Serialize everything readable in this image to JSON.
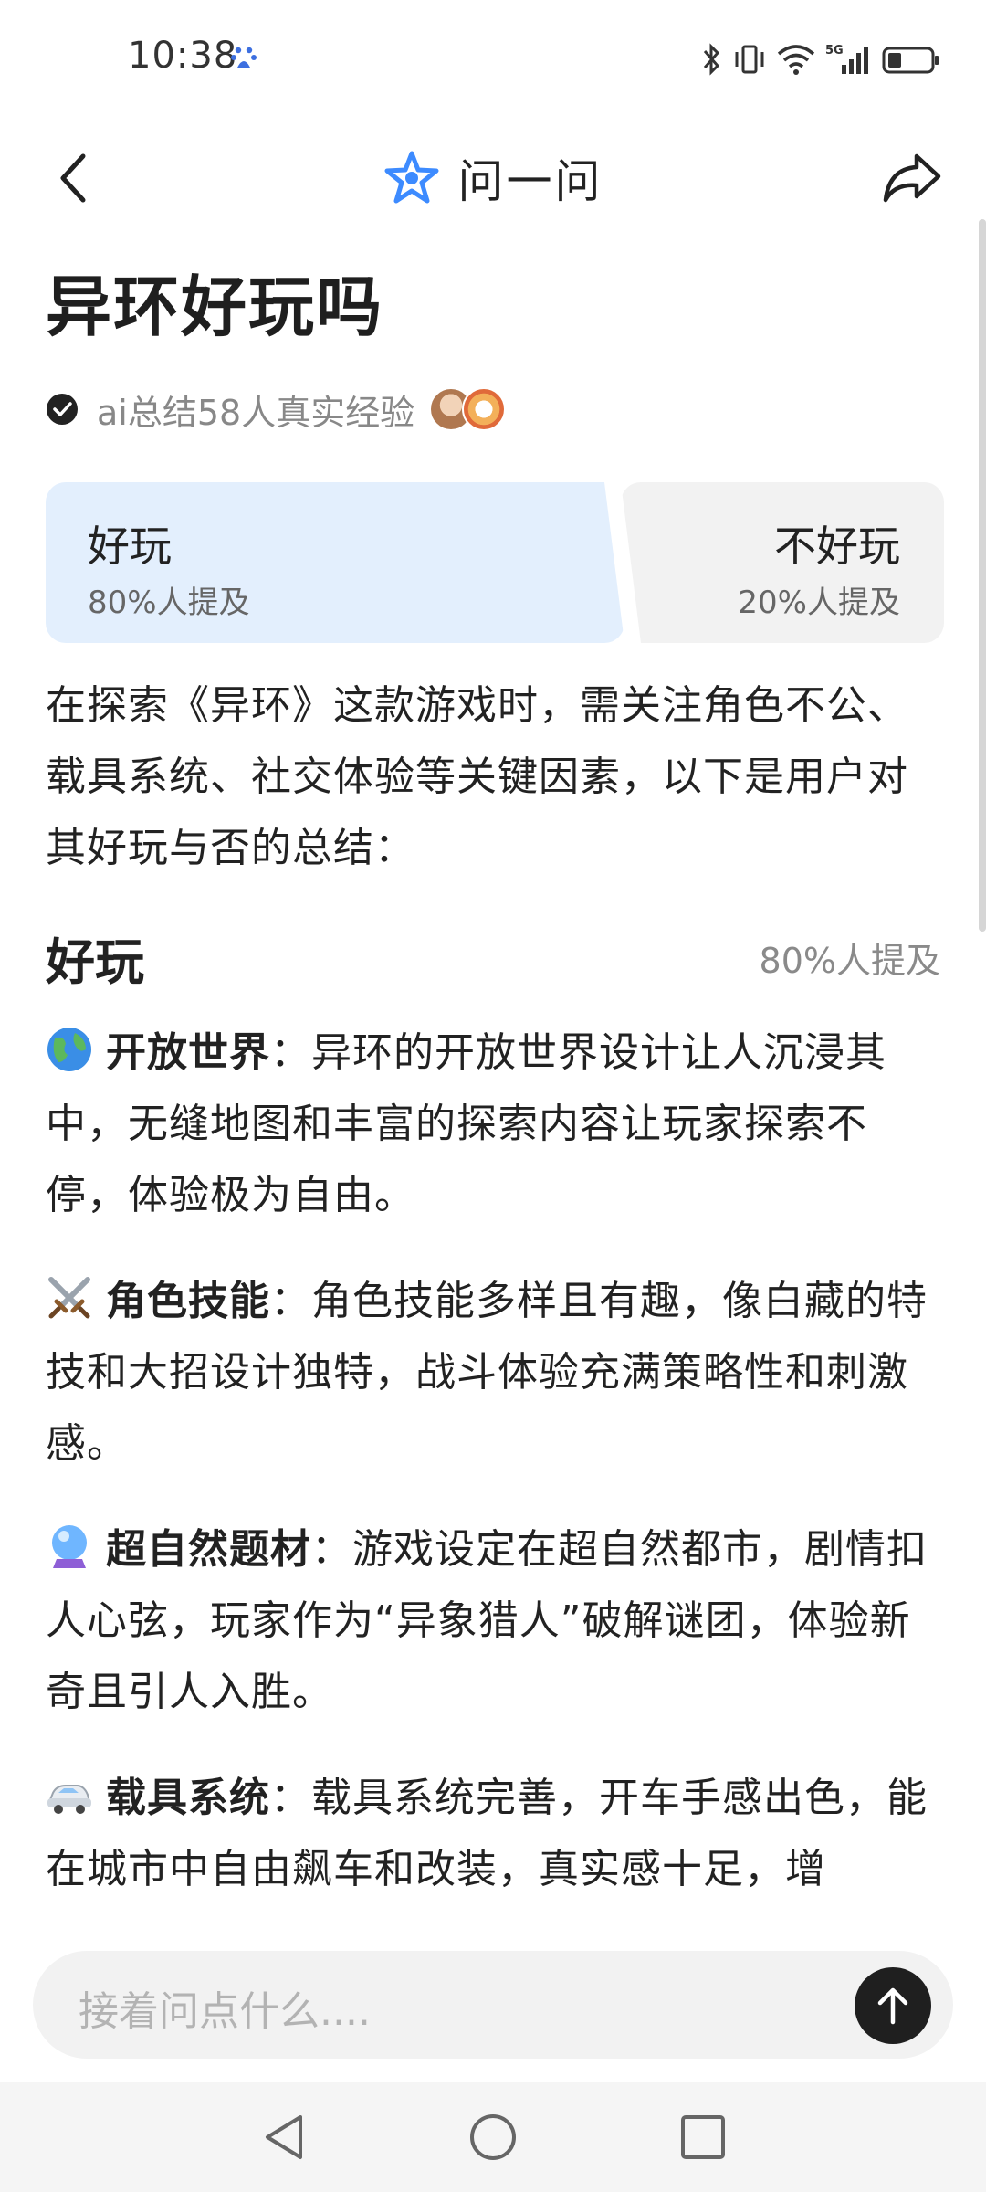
{
  "status_bar": {
    "time": "10:38",
    "icons": [
      "baidu-icon",
      "bluetooth-icon",
      "vibrate-icon",
      "wifi-icon",
      "5g-signal-icon",
      "battery-icon"
    ],
    "network_label": "5G"
  },
  "nav": {
    "title": "问一问",
    "back_icon": "chevron-left-icon",
    "share_icon": "share-icon"
  },
  "page": {
    "title": "异环好玩吗",
    "summary": "ai总结58人真实经验"
  },
  "vote": {
    "good": {
      "label": "好玩",
      "sub": "80%人提及",
      "percent": 80
    },
    "bad": {
      "label": "不好玩",
      "sub": "20%人提及",
      "percent": 20
    }
  },
  "intro": "在探索《异环》这款游戏时，需关注角色不公、载具系统、社交体验等关键因素，以下是用户对其好玩与否的总结：",
  "section": {
    "title": "好玩",
    "meta": "80%人提及",
    "points": [
      {
        "icon": "globe-icon",
        "heading": "开放世界",
        "text": "：异环的开放世界设计让人沉浸其中，无缝地图和丰富的探索内容让玩家探索不停，体验极为自由。"
      },
      {
        "icon": "crossed-swords-icon",
        "heading": "角色技能",
        "text": "：角色技能多样且有趣，像白藏的特技和大招设计独特，战斗体验充满策略性和刺激感。"
      },
      {
        "icon": "crystal-ball-icon",
        "heading": "超自然题材",
        "text": "：游戏设定在超自然都市，剧情扣人心弦，玩家作为“异象猎人”破解谜团，体验新奇且引人入胜。"
      },
      {
        "icon": "car-icon",
        "heading": "载具系统",
        "text": "：载具系统完善，开车手感出色，能在城市中自由飙车和改装，真实感十足，增"
      }
    ]
  },
  "ask": {
    "placeholder": "接着问点什么...."
  },
  "colors": {
    "good_card": "#e3effd",
    "bad_card": "#f2f2f2",
    "brand_blue": "#3d8bff"
  }
}
